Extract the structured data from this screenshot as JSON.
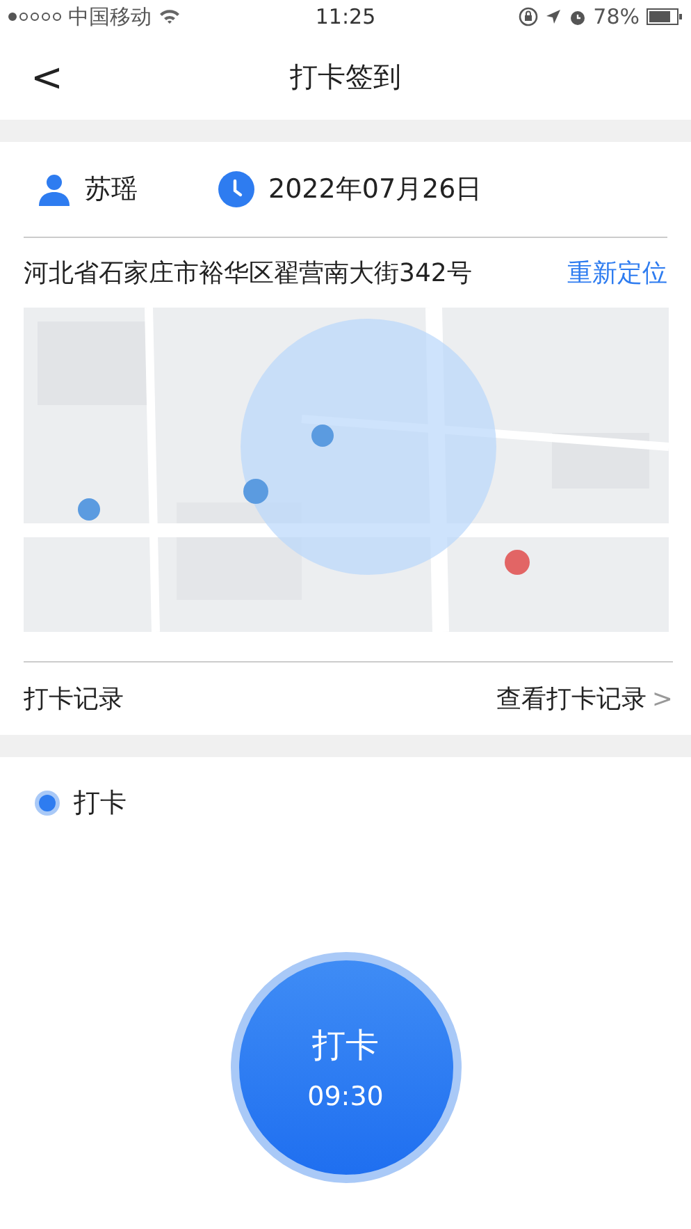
{
  "status_bar": {
    "carrier": "中国移动",
    "time": "11:25",
    "battery": "78%"
  },
  "nav": {
    "back": "<",
    "title": "打卡签到"
  },
  "info": {
    "user": "苏瑶",
    "date": "2022年07月26日"
  },
  "location": {
    "address": "河北省石家庄市裕华区翟营南大街342号",
    "relocate": "重新定位"
  },
  "record": {
    "label": "打卡记录",
    "link": "查看打卡记录",
    "chevron": ">"
  },
  "punch": {
    "section": "打卡",
    "button_label": "打卡",
    "button_time": "09:30"
  }
}
